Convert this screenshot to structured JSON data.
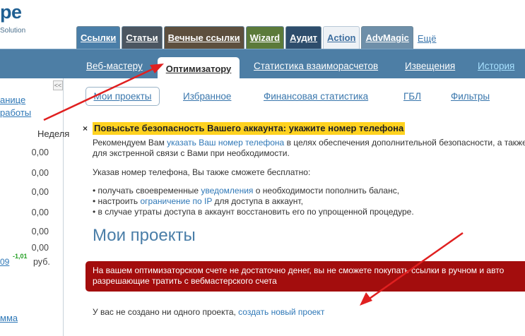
{
  "logo": {
    "text": "pe",
    "subtitle": "Solution"
  },
  "top_tabs": [
    {
      "label": "Ссылки"
    },
    {
      "label": "Статьи"
    },
    {
      "label": "Вечные ссылки"
    },
    {
      "label": "Wizard"
    },
    {
      "label": "Аудит"
    },
    {
      "label": "Action"
    },
    {
      "label": "AdvMagic"
    }
  ],
  "top_more": "Ещё",
  "nav": {
    "webmaster": "Веб-мастеру",
    "optimizer": "Оптимизатору",
    "stats": "Статистика взаиморасчетов",
    "notices": "Извещения",
    "history": "История"
  },
  "sidebar": {
    "collapse": "<<",
    "link1": "анице",
    "link2": "работы",
    "week_label": "Неделя",
    "values": [
      "0,00",
      "0,00",
      "0,00",
      "0,00",
      "0,00",
      "0,00"
    ],
    "small_value": "-1,01",
    "value_09": "09",
    "value_last": "0,00",
    "currency": "руб.",
    "bottom_link": "мма"
  },
  "subnav": {
    "my_projects": "Мои проекты",
    "favorites": "Избранное",
    "finance": "Финансовая статистика",
    "gbl": "ГБЛ",
    "filters": "Фильтры"
  },
  "alert": {
    "close": "×",
    "headline": "Повысьте безопасность Вашего аккаунта: укажите номер телефона",
    "p1_before": "Рекомендуем Вам ",
    "p1_link": "указать Ваш номер телефона",
    "p1_after": " в целях обеспечения дополнительной безопасности, а также для экстренной связи с Вами при необходимости.",
    "p2": "Указав номер телефона, Вы также сможете бесплатно:",
    "li1_before": "получать своевременные ",
    "li1_link": "уведомления",
    "li1_after": " о необходимости пополнить баланс,",
    "li2_before": "настроить ",
    "li2_link": "ограничение по IP",
    "li2_after": " для доступа в аккаунт,",
    "li3": "в случае утраты доступа в аккаунт восстановить его по упрощенной процедуре."
  },
  "projects": {
    "title": "Мои проекты",
    "warning_line1": "На вашем оптимизаторском счете не достаточно денег, вы не сможете покупать ссылки в ручном и авто",
    "warning_line2": "разрешающие тратить с вебмастерского счета",
    "empty_before": "У вас не создано ни одного проекта, ",
    "empty_link": "создать новый проект"
  },
  "colors": {
    "nav_bar": "#4d7ea5",
    "alert_highlight": "#ffd21f",
    "warning_box": "#a30d0d",
    "arrow": "#e02020"
  }
}
